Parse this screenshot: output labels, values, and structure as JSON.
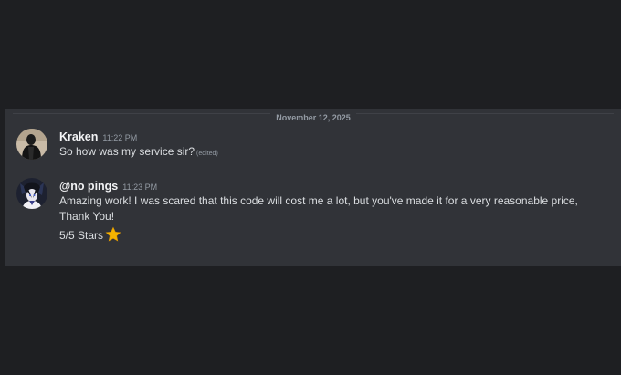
{
  "divider": {
    "date": "November 12, 2025"
  },
  "messages": [
    {
      "username": "Kraken",
      "timestamp": "11:22 PM",
      "lines": [
        "So how was my service sir?"
      ],
      "edited_label": "(edited)",
      "avatar_icon": "dark-figure-avatar"
    },
    {
      "username": "@no pings",
      "timestamp": "11:23 PM",
      "lines": [
        "Amazing work! I was scared that this code will cost me a lot, but you've made it for a very reasonable price,",
        "Thank You!",
        "5/5 Stars"
      ],
      "emoji": "star-icon",
      "avatar_icon": "anime-character-avatar"
    }
  ],
  "colors": {
    "page_background": "#1e1f22",
    "chat_background": "#313338",
    "username": "#f2f3f5",
    "message_text": "#dbdee1",
    "muted_text": "#949ba4",
    "star": "#f4b400"
  }
}
